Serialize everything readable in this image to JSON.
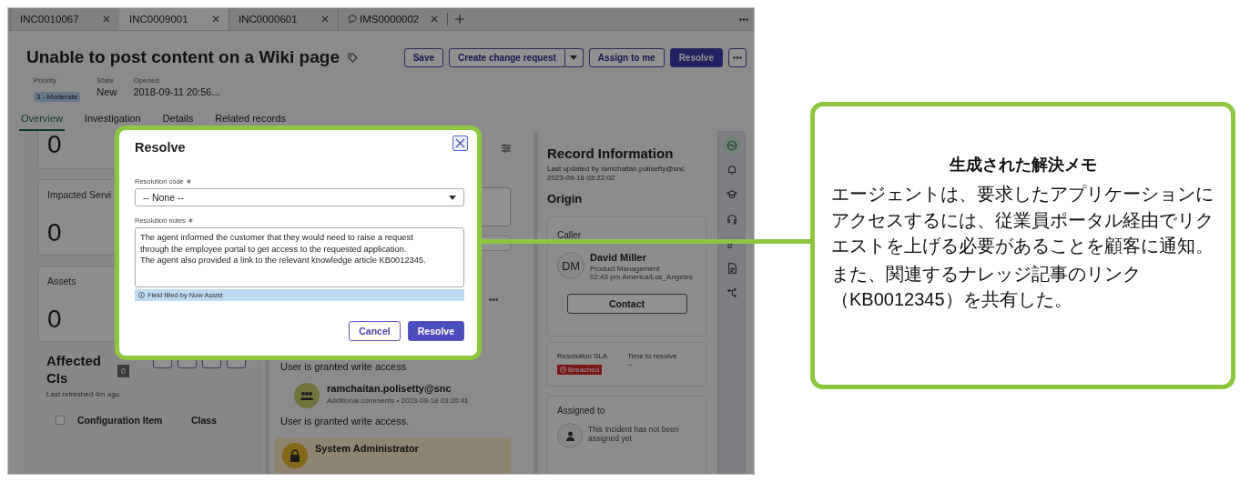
{
  "tabs": [
    {
      "label": "INC0010067",
      "kind": "record",
      "selected": false
    },
    {
      "label": "INC0009001",
      "kind": "record",
      "selected": true
    },
    {
      "label": "INC0000601",
      "kind": "record",
      "selected": false
    },
    {
      "label": "IMS0000002",
      "kind": "chat",
      "selected": false
    }
  ],
  "record": {
    "title": "Unable to post content on a Wiki page",
    "actions": [
      {
        "label": "Save",
        "kind": "secondary"
      },
      {
        "label": "Create change request",
        "kind": "split"
      },
      {
        "label": "Assign to me",
        "kind": "secondary"
      },
      {
        "label": "Resolve",
        "kind": "primary"
      }
    ],
    "fields": [
      {
        "label": "Priority",
        "value": "3 - Moderate",
        "kind": "badge"
      },
      {
        "label": "State",
        "value": "New",
        "kind": "plain"
      },
      {
        "label": "Opened",
        "value": "2018-09-11 20:56...",
        "kind": "plain"
      }
    ]
  },
  "section_tabs": [
    {
      "label": "Overview",
      "selected": true
    },
    {
      "label": "Investigation",
      "selected": false
    },
    {
      "label": "Details",
      "selected": false
    },
    {
      "label": "Related records",
      "selected": false
    }
  ],
  "metric_cards": [
    {
      "value": "0"
    },
    {
      "label": "Impacted Servi",
      "value": "0"
    },
    {
      "label": "Assets",
      "value": "0"
    }
  ],
  "affected_cis": {
    "title": "Affected CIs",
    "count": "0",
    "refreshed": "Last refreshed 4m ago",
    "select_all": {
      "checked": false
    },
    "columns": [
      "Configuration Item",
      "Class"
    ]
  },
  "activity": [
    {
      "kind": "plain",
      "text": "User is granted write access"
    },
    {
      "kind": "comment",
      "author": "ramchaitan.polisetty@snc",
      "meta": "Additional comments • 2023-09-18 03:20:41",
      "text": "User is granted write access."
    },
    {
      "kind": "system",
      "author": "System Administrator"
    }
  ],
  "record_info": {
    "title": "Record Information",
    "updated": "Last updated by ramchaitan.polisetty@snc",
    "timestamp": "2023-09-18 03:22:02",
    "section": "Origin",
    "caller": {
      "heading": "Caller",
      "initials": "DM",
      "name": "David Miller",
      "department": "Product Management",
      "local_time": "02:43 pm America/Los_Angeles",
      "button": "Contact"
    },
    "sla": {
      "label": "Resolution SLA",
      "status": "Breached",
      "time_label": "Time to resolve",
      "time_value": "--"
    },
    "assigned": {
      "heading": "Assigned to",
      "text": "This Incident has not been assigned yet"
    }
  },
  "rail": [
    {
      "kind": "activity",
      "selected": true
    },
    {
      "kind": "bell",
      "selected": false
    },
    {
      "kind": "cap",
      "selected": false
    },
    {
      "kind": "headset",
      "selected": false
    },
    {
      "kind": "link",
      "selected": false
    },
    {
      "kind": "document",
      "selected": false
    },
    {
      "kind": "flow",
      "selected": false
    }
  ],
  "dialog": {
    "title": "Resolve",
    "fields": [
      {
        "kind": "select",
        "label": "Resolution code ∗",
        "value": "-- None --"
      },
      {
        "kind": "textarea",
        "label": "Resolution notes ∗",
        "value": "The agent informed the customer that they would need to raise a request through the employee portal to get access to the requested application.\nThe agent also provided a link to the relevant knowledge article KB0012345.",
        "note": "Field filled by Now Assist"
      }
    ],
    "buttons": [
      {
        "label": "Cancel",
        "kind": "secondary"
      },
      {
        "label": "Resolve",
        "kind": "primary"
      }
    ]
  },
  "callout": {
    "title": "生成された解決メモ",
    "paragraphs": [
      "エージェントは、要求したアプリケーションにアクセスするには、従業員ポータル経由でリクエストを上げる必要があることを顧客に通知。",
      "また、関連するナレッジ記事のリンク（KB0012345）を共有した。"
    ]
  }
}
